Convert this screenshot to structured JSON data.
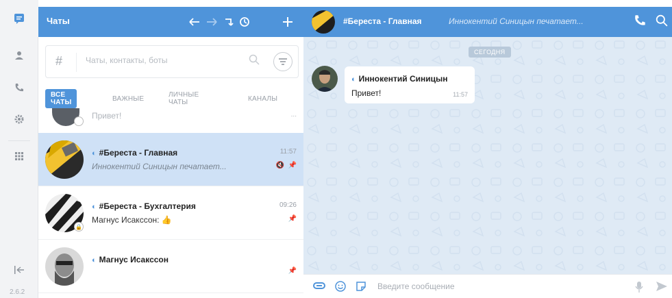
{
  "rail": {
    "items": [
      {
        "icon": "chat-icon",
        "active": true
      },
      {
        "icon": "contacts-icon"
      },
      {
        "icon": "calls-icon"
      },
      {
        "icon": "settings-icon"
      },
      {
        "icon": "apps-grid-icon"
      }
    ],
    "collapse_icon": "collapse-left-icon",
    "version": "2.6.2"
  },
  "chats_panel": {
    "title": "Чаты",
    "header_icons": [
      "back-arrow-icon",
      "forward-arrow-icon",
      "reply-icon",
      "history-icon",
      "plus-icon"
    ],
    "search": {
      "prefix": "#",
      "placeholder": "Чаты, контакты, боты"
    },
    "tabs": [
      {
        "label": "ВСЕ ЧАТЫ",
        "active": true
      },
      {
        "label": "ВАЖНЫЕ"
      },
      {
        "label": "ЛИЧНЫЕ ЧАТЫ"
      },
      {
        "label": "КАНАЛЫ"
      }
    ],
    "partial_item": {
      "preview": "Привет!",
      "time": "..."
    },
    "items": [
      {
        "name": "#Береста - Главная",
        "preview": "Иннокентий Синицын печатает...",
        "time": "11:57",
        "active": true,
        "typing": true,
        "muted": true,
        "pinned": true
      },
      {
        "name": "#Береста - Бухгалтерия",
        "preview": "Магнус Исакссон: 👍",
        "time": "09:26",
        "pinned": true
      },
      {
        "name": "Магнус Исакссон",
        "preview": "",
        "time": "",
        "pinned": true
      }
    ]
  },
  "conversation": {
    "title": "#Береста - Главная",
    "typing": "Иннокентий Синицын печатает...",
    "header_icons": [
      "phone-icon",
      "search-icon"
    ],
    "date_badge": "СЕГОДНЯ",
    "message": {
      "author": "Иннокентий Синицын",
      "text": "Привет!",
      "time": "11:57"
    },
    "input": {
      "placeholder": "Введите сообщение"
    }
  },
  "colors": {
    "accent": "#4f94da",
    "active_row": "#cfe1f6",
    "chat_bg": "#dfeaf5"
  }
}
